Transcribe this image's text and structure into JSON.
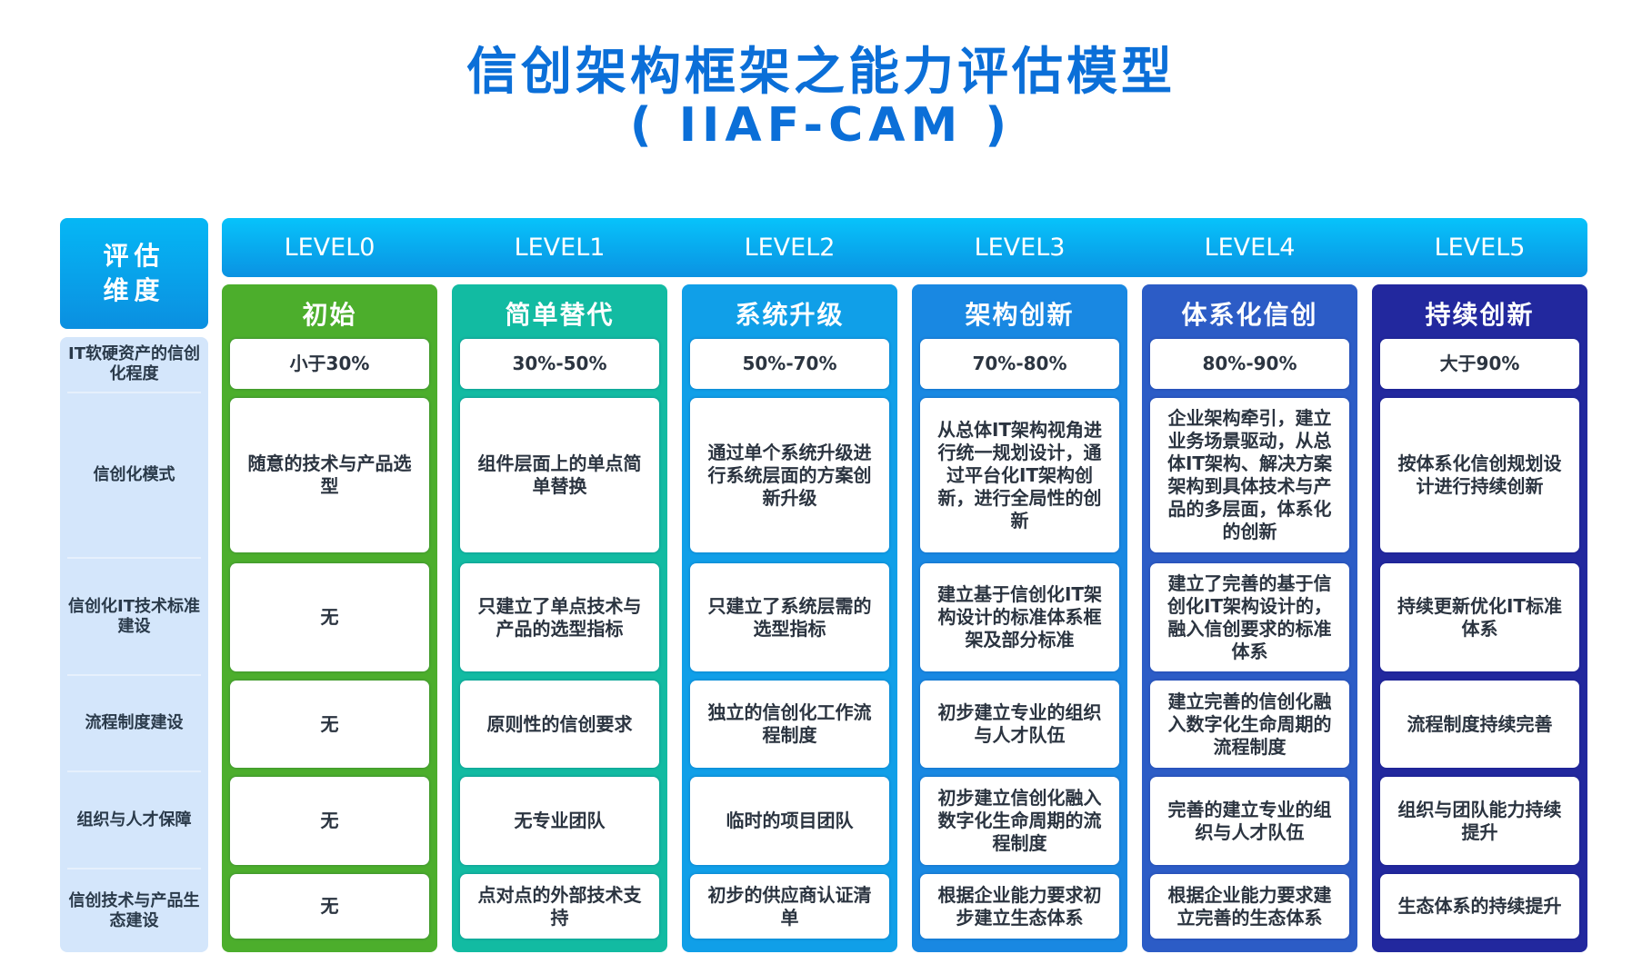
{
  "title": {
    "line1": "信创架构框架之能力评估模型",
    "line2": "( IIAF-CAM )"
  },
  "dimension_header": "评估维度",
  "dimensions": [
    "IT软硬资产的信创化程度",
    "信创化模式",
    "信创化IT技术标准建设",
    "流程制度建设",
    "组织与人才保障",
    "信创技术与产品生态建设"
  ],
  "levels": [
    {
      "level": "LEVEL0",
      "name": "初始",
      "color": "#4cae2c",
      "cells": [
        "小于30%",
        "随意的技术与产品选型",
        "无",
        "无",
        "无",
        "无"
      ]
    },
    {
      "level": "LEVEL1",
      "name": "简单替代",
      "color": "#12bba2",
      "cells": [
        "30%-50%",
        "组件层面上的单点简单替换",
        "只建立了单点技术与产品的选型指标",
        "原则性的信创要求",
        "无专业团队",
        "点对点的外部技术支持"
      ]
    },
    {
      "level": "LEVEL2",
      "name": "系统升级",
      "color": "#109fe8",
      "cells": [
        "50%-70%",
        "通过单个系统升级进行系统层面的方案创新升级",
        "只建立了系统层需的选型指标",
        "独立的信创化工作流程制度",
        "临时的项目团队",
        "初步的供应商认证清单"
      ]
    },
    {
      "level": "LEVEL3",
      "name": "架构创新",
      "color": "#1988e2",
      "cells": [
        "70%-80%",
        "从总体IT架构视角进行统一规划设计，通过平台化IT架构创新，进行全局性的创新",
        "建立基于信创化IT架构设计的标准体系框架及部分标准",
        "初步建立专业的组织与人才队伍",
        "初步建立信创化融入数字化生命周期的流程制度",
        "根据企业能力要求初步建立生态体系"
      ]
    },
    {
      "level": "LEVEL4",
      "name": "体系化信创",
      "color": "#2c5cc6",
      "cells": [
        "80%-90%",
        "企业架构牵引，建立业务场景驱动，从总体IT架构、解决方案架构到具体技术与产品的多层面，体系化的创新",
        "建立了完善的基于信创化IT架构设计的，融入信创要求的标准体系",
        "建立完善的信创化融入数字化生命周期的流程制度",
        "完善的建立专业的组织与人才队伍",
        "根据企业能力要求建立完善的生态体系"
      ]
    },
    {
      "level": "LEVEL5",
      "name": "持续创新",
      "color": "#22289e",
      "cells": [
        "大于90%",
        "按体系化信创规划设计进行持续创新",
        "持续更新优化IT标准体系",
        "流程制度持续完善",
        "组织与团队能力持续提升",
        "生态体系的持续提升"
      ]
    }
  ]
}
